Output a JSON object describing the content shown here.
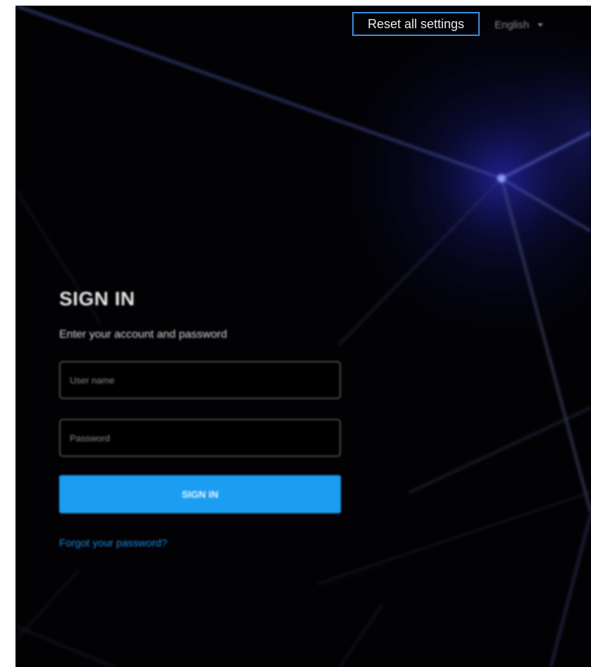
{
  "header": {
    "reset_label": "Reset all settings",
    "language": "English"
  },
  "login": {
    "title": "SIGN IN",
    "subtitle": "Enter your account and password",
    "username_placeholder": "User name",
    "password_placeholder": "Password",
    "submit_label": "SIGN IN",
    "forgot_label": "Forgot your password?"
  },
  "colors": {
    "background": "#020205",
    "accent": "#1b9ef2",
    "link": "#1a8ad8",
    "glow": "#3b3bff"
  }
}
